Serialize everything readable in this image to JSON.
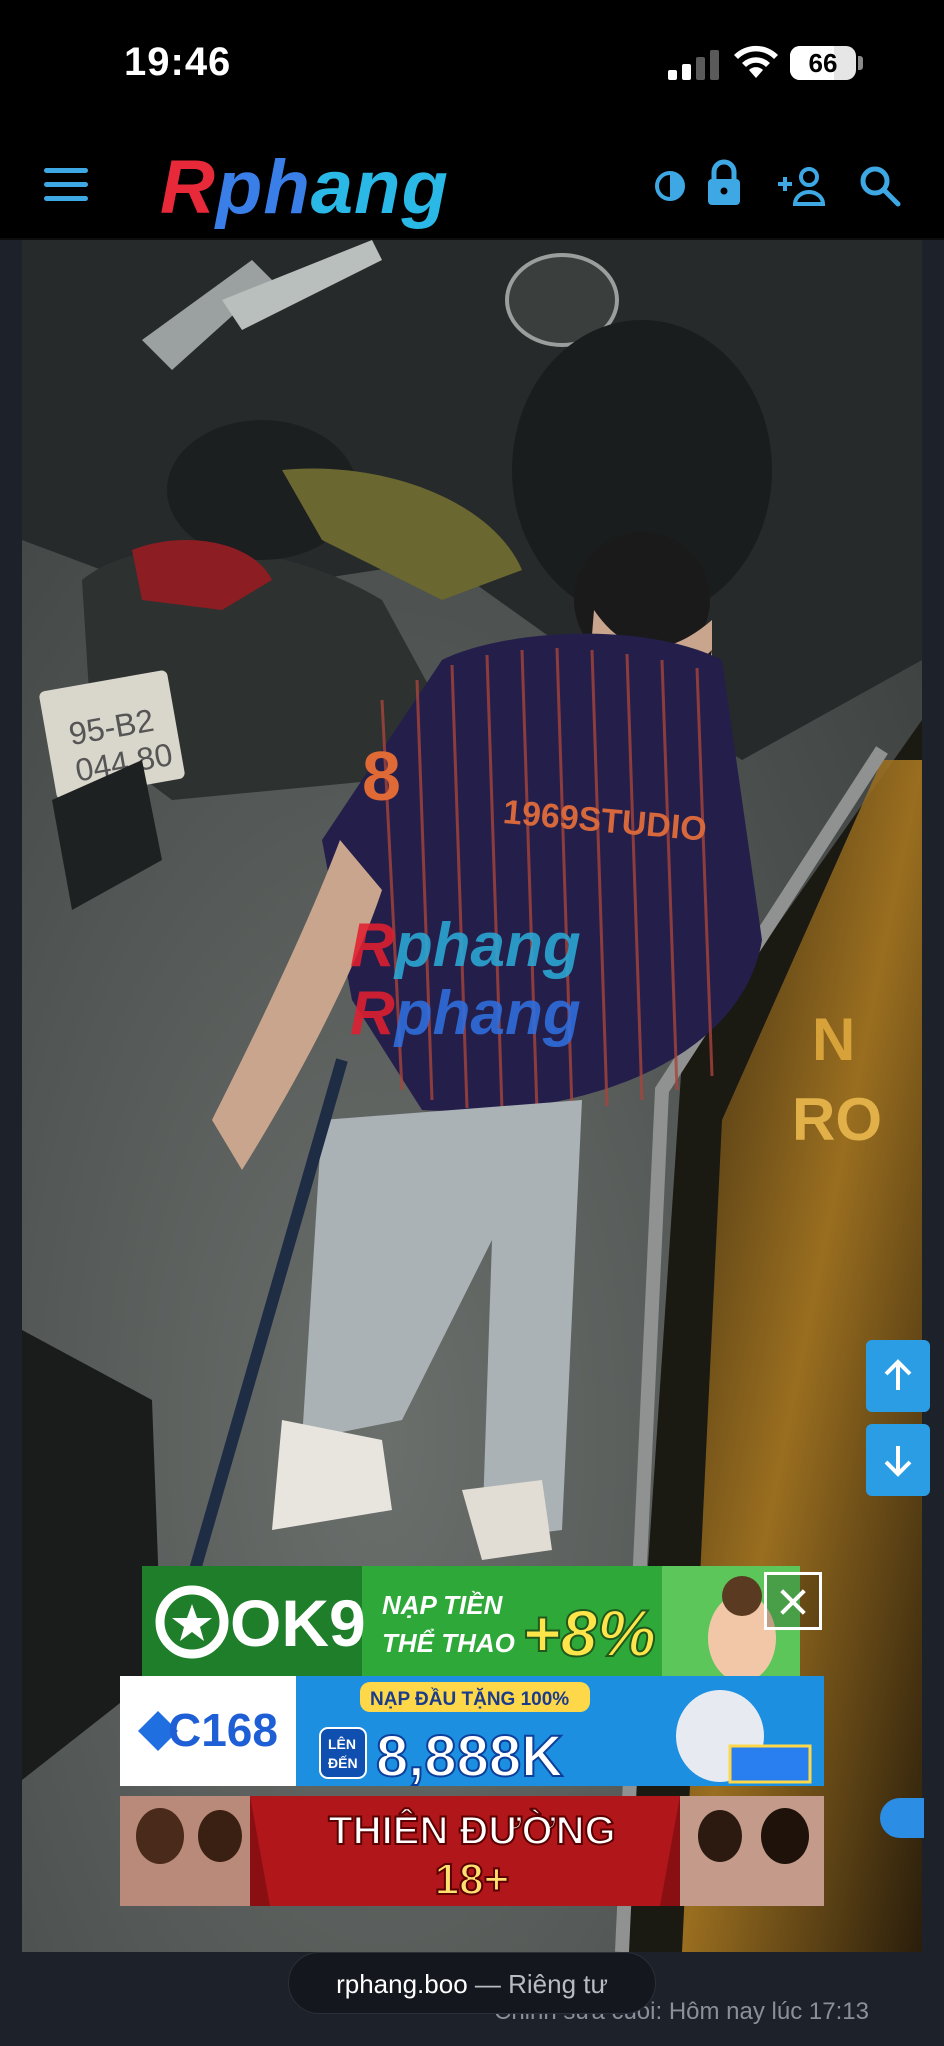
{
  "status_bar": {
    "time": "19:46",
    "battery_percent": 66
  },
  "header": {
    "logo_text": "Rphang",
    "icons": [
      "menu-icon",
      "contrast-icon",
      "lock-icon",
      "add-user-icon",
      "search-icon"
    ]
  },
  "watermark": [
    "Rphang",
    "Rphang"
  ],
  "ads": {
    "ok9": {
      "brand": "OK9",
      "line1": "NẠP TIỀN",
      "line2": "THỂ THAO",
      "bonus": "+8%"
    },
    "c168": {
      "brand": "C168",
      "promo": "NẠP ĐẦU TẶNG 100%",
      "prefix_line1": "LÊN",
      "prefix_line2": "ĐẾN",
      "amount": "8,888K"
    },
    "thien": {
      "line1": "THIÊN ĐƯỜNG",
      "line2": "18+"
    }
  },
  "url_bar": {
    "domain": "rphang.boo",
    "separator": " — ",
    "mode": "Riêng tư"
  },
  "footer": {
    "edited_text": "Chỉnh sửa cuối: Hôm nay lúc 17:13"
  },
  "colors": {
    "accent": "#2b9de4",
    "header_bg": "#000000",
    "page_bg": "#1d2129"
  }
}
